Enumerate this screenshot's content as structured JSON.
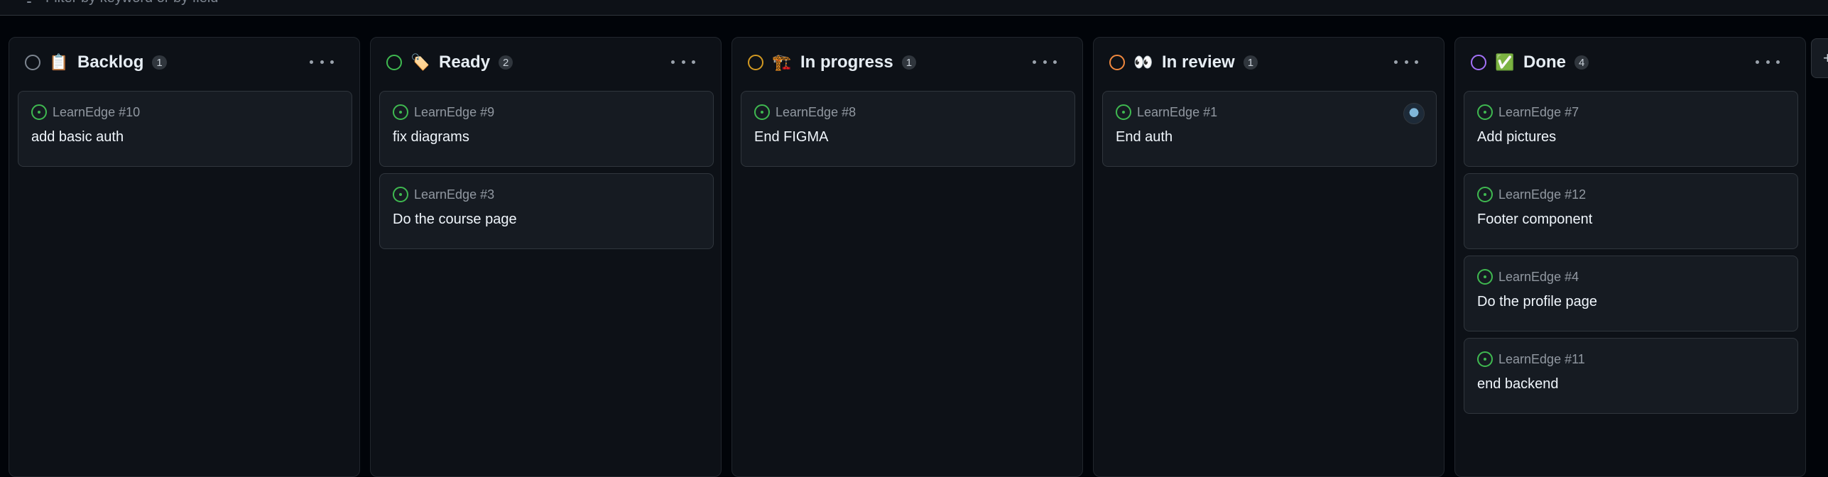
{
  "filter": {
    "placeholder": "Filter by keyword or by field",
    "icon": "filter-icon"
  },
  "columns": [
    {
      "title": "Backlog",
      "emoji": "📋",
      "count": "1",
      "status_color": "#7d8590",
      "cards": [
        {
          "ref": "LearnEdge #10",
          "title": "add basic auth"
        }
      ]
    },
    {
      "title": "Ready",
      "emoji": "🏷️",
      "count": "2",
      "status_color": "#3fb950",
      "cards": [
        {
          "ref": "LearnEdge #9",
          "title": "fix diagrams"
        },
        {
          "ref": "LearnEdge #3",
          "title": "Do the course page"
        }
      ]
    },
    {
      "title": "In progress",
      "emoji": "🏗️",
      "count": "1",
      "status_color": "#d29922",
      "cards": [
        {
          "ref": "LearnEdge #8",
          "title": "End FIGMA"
        }
      ]
    },
    {
      "title": "In review",
      "emoji": "👀",
      "count": "1",
      "status_color": "#f0883e",
      "cards": [
        {
          "ref": "LearnEdge #1",
          "title": "End auth",
          "has_avatar": true
        }
      ]
    },
    {
      "title": "Done",
      "emoji": "✅",
      "count": "4",
      "status_color": "#a371f7",
      "cards": [
        {
          "ref": "LearnEdge #7",
          "title": "Add pictures"
        },
        {
          "ref": "LearnEdge #12",
          "title": "Footer component"
        },
        {
          "ref": "LearnEdge #4",
          "title": "Do the profile page"
        },
        {
          "ref": "LearnEdge #11",
          "title": "end backend"
        }
      ]
    }
  ],
  "add_column_label": "+"
}
